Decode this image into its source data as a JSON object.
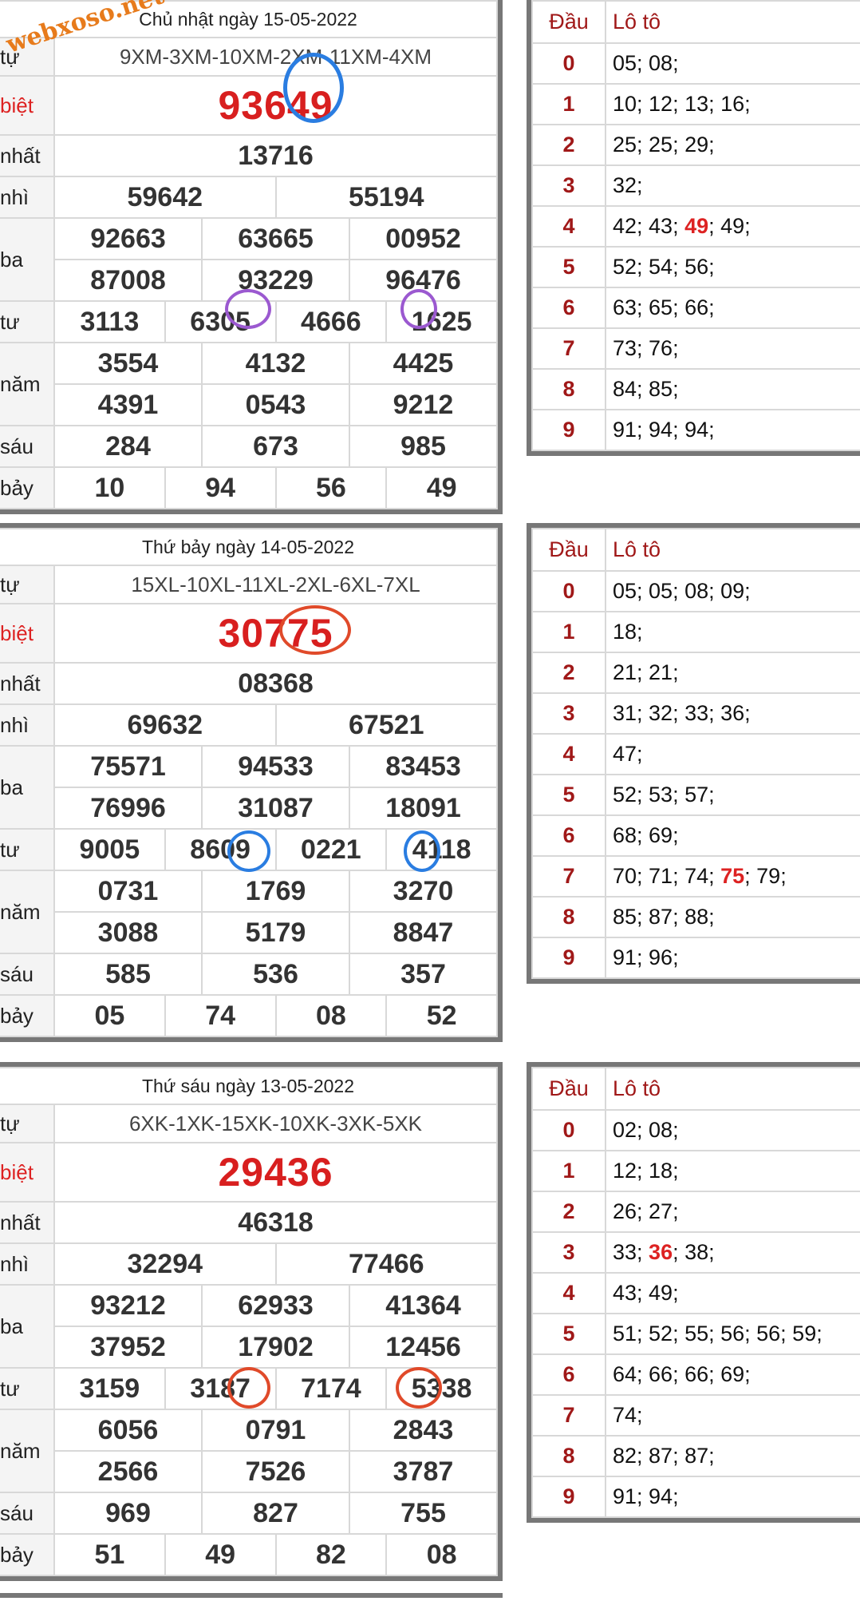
{
  "watermark": "webxoso.net",
  "colors": {
    "special": "#d81f1f",
    "loto_head": "#a01818",
    "border": "#777777"
  },
  "labels": {
    "code": "tự",
    "special": "biệt",
    "first": "nhất",
    "second": "nhì",
    "third": "ba",
    "fourth": "tư",
    "fifth": "năm",
    "sixth": "sáu",
    "seventh": "bảy"
  },
  "loto_headers": {
    "dau": "Đầu",
    "loto": "Lô tô"
  },
  "draws": [
    {
      "date_title": "Chủ nhật ngày 15-05-2022",
      "code": "9XM-3XM-10XM-2XM-11XM-4XM",
      "special": "93649",
      "first": "13716",
      "second": [
        "59642",
        "55194"
      ],
      "third": [
        [
          "92663",
          "63665",
          "00952"
        ],
        [
          "87008",
          "93229",
          "96476"
        ]
      ],
      "fourth": [
        "3113",
        "6305",
        "4666",
        "1625"
      ],
      "fifth": [
        [
          "3554",
          "4132",
          "4425"
        ],
        [
          "4391",
          "0543",
          "9212"
        ]
      ],
      "sixth": [
        "284",
        "673",
        "985"
      ],
      "seventh": [
        "10",
        "94",
        "56",
        "49"
      ],
      "loto": [
        [
          "0",
          "05; 08;"
        ],
        [
          "1",
          "10; 12; 13; 16;"
        ],
        [
          "2",
          "25; 25; 29;"
        ],
        [
          "3",
          "32;"
        ],
        [
          "4",
          "42; 43; ",
          "49",
          "; 49;"
        ],
        [
          "5",
          "52; 54; 56;"
        ],
        [
          "6",
          "63; 65; 66;"
        ],
        [
          "7",
          "73; 76;"
        ],
        [
          "8",
          "84; 85;"
        ],
        [
          "9",
          "91; 94; 94;"
        ]
      ]
    },
    {
      "date_title": "Thứ bảy ngày 14-05-2022",
      "code": "15XL-10XL-11XL-2XL-6XL-7XL",
      "special": "30775",
      "first": "08368",
      "second": [
        "69632",
        "67521"
      ],
      "third": [
        [
          "75571",
          "94533",
          "83453"
        ],
        [
          "76996",
          "31087",
          "18091"
        ]
      ],
      "fourth": [
        "9005",
        "8609",
        "0221",
        "4118"
      ],
      "fifth": [
        [
          "0731",
          "1769",
          "3270"
        ],
        [
          "3088",
          "5179",
          "8847"
        ]
      ],
      "sixth": [
        "585",
        "536",
        "357"
      ],
      "seventh": [
        "05",
        "74",
        "08",
        "52"
      ],
      "loto": [
        [
          "0",
          "05; 05; 08; 09;"
        ],
        [
          "1",
          "18;"
        ],
        [
          "2",
          "21; 21;"
        ],
        [
          "3",
          "31; 32; 33; 36;"
        ],
        [
          "4",
          "47;"
        ],
        [
          "5",
          "52; 53; 57;"
        ],
        [
          "6",
          "68; 69;"
        ],
        [
          "7",
          "70; 71; 74; ",
          "75",
          "; 79;"
        ],
        [
          "8",
          "85; 87; 88;"
        ],
        [
          "9",
          "91; 96;"
        ]
      ]
    },
    {
      "date_title": "Thứ sáu ngày 13-05-2022",
      "code": "6XK-1XK-15XK-10XK-3XK-5XK",
      "special": "29436",
      "first": "46318",
      "second": [
        "32294",
        "77466"
      ],
      "third": [
        [
          "93212",
          "62933",
          "41364"
        ],
        [
          "37952",
          "17902",
          "12456"
        ]
      ],
      "fourth": [
        "3159",
        "3187",
        "7174",
        "5338"
      ],
      "fifth": [
        [
          "6056",
          "0791",
          "2843"
        ],
        [
          "2566",
          "7526",
          "3787"
        ]
      ],
      "sixth": [
        "969",
        "827",
        "755"
      ],
      "seventh": [
        "51",
        "49",
        "82",
        "08"
      ],
      "loto": [
        [
          "0",
          "02; 08;"
        ],
        [
          "1",
          "12; 18;"
        ],
        [
          "2",
          "26; 27;"
        ],
        [
          "3",
          "33; ",
          "36",
          "; 38;"
        ],
        [
          "4",
          "43; 49;"
        ],
        [
          "5",
          "51; 52; 55; 56; 56; 59;"
        ],
        [
          "6",
          "64; 66; 66; 69;"
        ],
        [
          "7",
          "74;"
        ],
        [
          "8",
          "82; 87; 87;"
        ],
        [
          "9",
          "91; 94;"
        ]
      ]
    }
  ]
}
